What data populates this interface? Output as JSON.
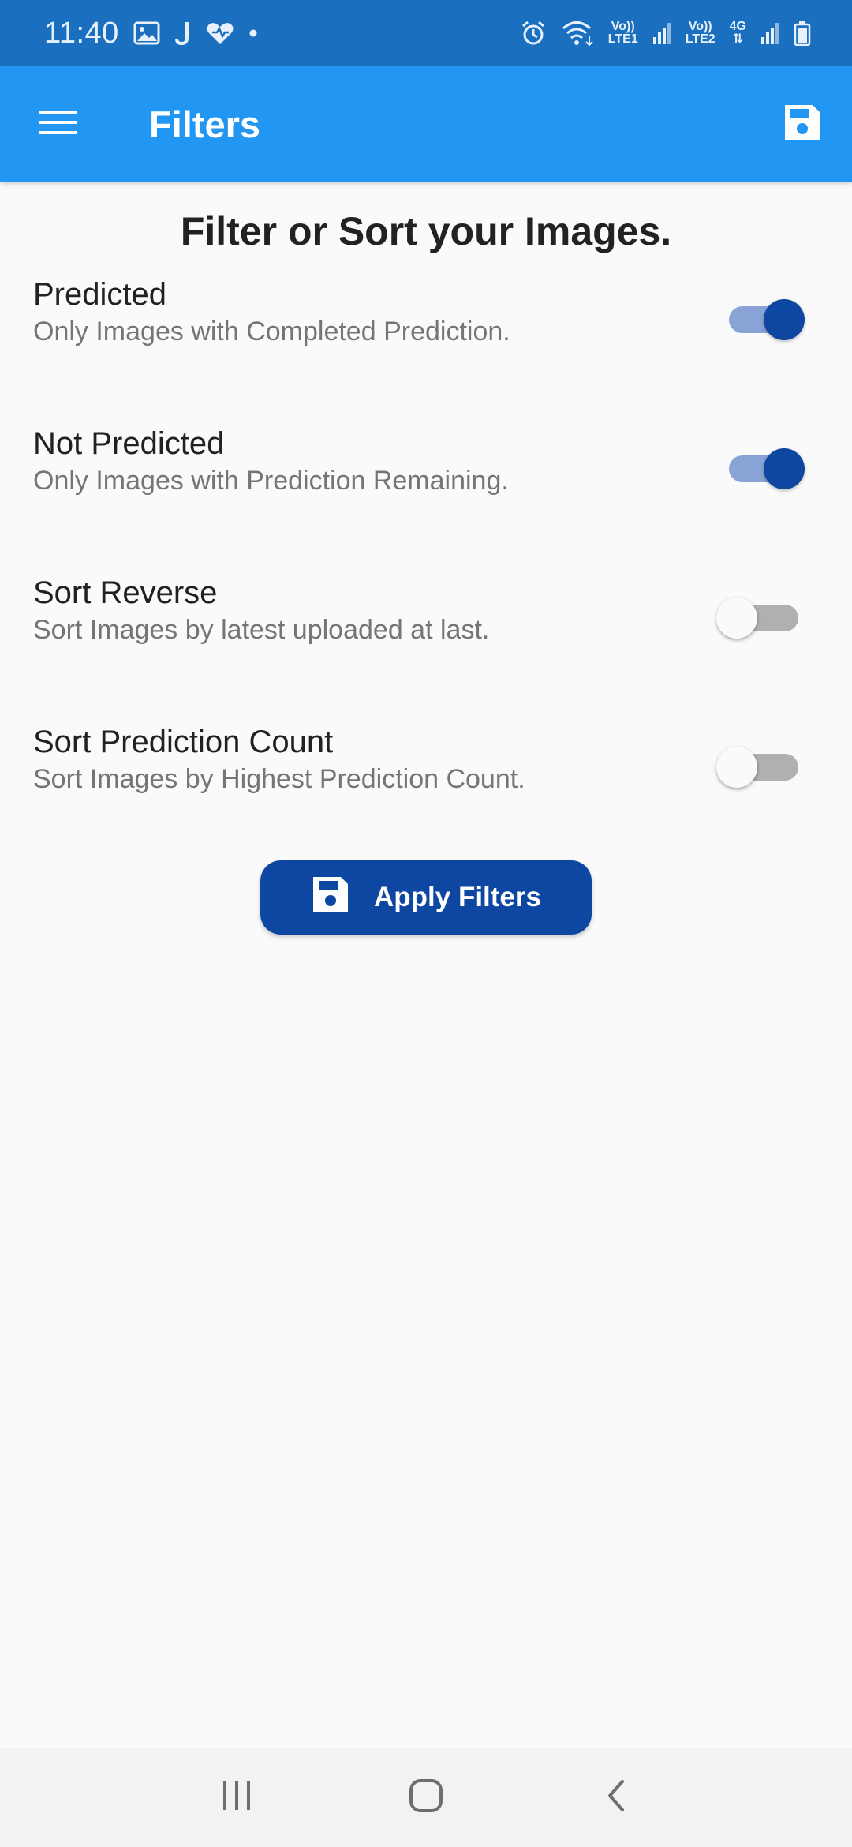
{
  "status_bar": {
    "time": "11:40",
    "left_icons": [
      "gallery-icon",
      "j-app-icon",
      "heart-icon",
      "dot-icon"
    ],
    "right_icons": [
      "alarm-icon",
      "wifi-icon",
      "signal-icon",
      "signal-icon",
      "battery-icon"
    ],
    "sim1_label_top": "Vo))",
    "sim1_label_bottom": "LTE1",
    "sim2_label_top": "Vo))",
    "sim2_label_bottom": "LTE2",
    "network_type": "4G"
  },
  "app_bar": {
    "title": "Filters",
    "menu_icon": "hamburger-icon",
    "action_icon": "save-icon",
    "background": "#2196f3"
  },
  "main": {
    "heading": "Filter or Sort your Images.",
    "filters": [
      {
        "title": "Predicted",
        "subtitle": "Only Images with Completed Prediction.",
        "enabled": true
      },
      {
        "title": "Not Predicted",
        "subtitle": "Only Images with Prediction Remaining.",
        "enabled": true
      },
      {
        "title": "Sort Reverse",
        "subtitle": "Sort Images by latest uploaded at last.",
        "enabled": false
      },
      {
        "title": "Sort Prediction Count",
        "subtitle": "Sort Images by Highest Prediction Count.",
        "enabled": false
      }
    ],
    "apply_button": {
      "label": "Apply Filters",
      "icon": "save-icon",
      "color": "#0d47a1"
    }
  },
  "nav_bar": {
    "buttons": [
      "recents-icon",
      "home-icon",
      "back-icon"
    ]
  }
}
